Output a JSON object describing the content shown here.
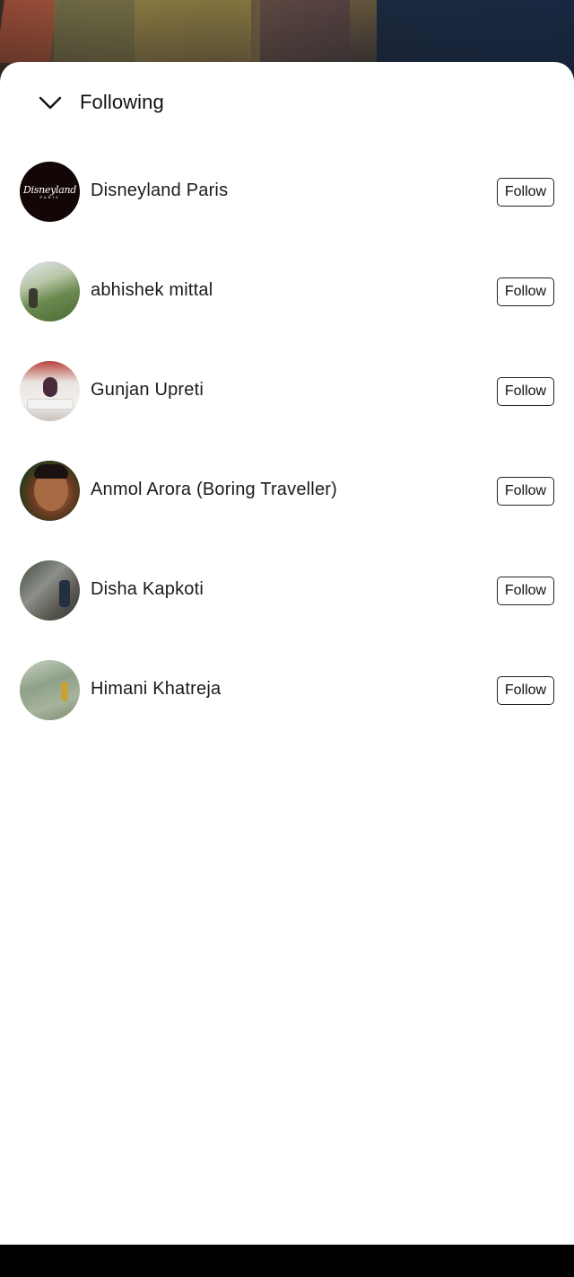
{
  "header": {
    "title": "Following"
  },
  "following": [
    {
      "name": "Disneyland Paris",
      "button": "Follow",
      "avatar_icon": "disneyland-logo",
      "logo_text": "Disneyland",
      "logo_sub": "PARIS"
    },
    {
      "name": "abhishek mittal",
      "button": "Follow",
      "avatar_icon": "mountain-photo"
    },
    {
      "name": "Gunjan Upreti",
      "button": "Follow",
      "avatar_icon": "person-photo"
    },
    {
      "name": "Anmol Arora (Boring Traveller)",
      "button": "Follow",
      "avatar_icon": "face-photo"
    },
    {
      "name": "Disha Kapkoti",
      "button": "Follow",
      "avatar_icon": "landscape-photo"
    },
    {
      "name": "Himani Khatreja",
      "button": "Follow",
      "avatar_icon": "field-photo"
    }
  ]
}
